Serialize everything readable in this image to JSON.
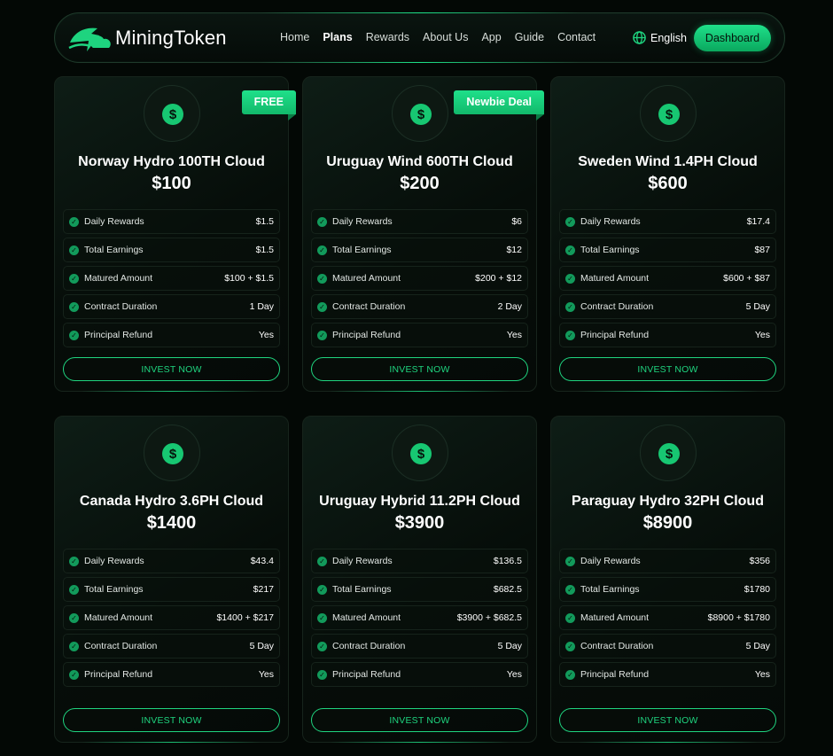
{
  "brand": {
    "name": "MiningToken",
    "accent": "#1de087"
  },
  "nav": {
    "links": [
      "Home",
      "Plans",
      "Rewards",
      "About Us",
      "App",
      "Guide",
      "Contact"
    ],
    "active": "Plans",
    "language": "English",
    "dashboard_label": "Dashboard"
  },
  "plans": [
    {
      "badge": "FREE",
      "name": "Norway Hydro 100TH Cloud",
      "price": "$100",
      "rows": [
        {
          "label": "Daily Rewards",
          "value": "$1.5"
        },
        {
          "label": "Total Earnings",
          "value": "$1.5"
        },
        {
          "label": "Matured Amount",
          "value": "$100 + $1.5"
        },
        {
          "label": "Contract Duration",
          "value": "1 Day"
        },
        {
          "label": "Principal Refund",
          "value": "Yes"
        }
      ],
      "cta": "INVEST NOW"
    },
    {
      "badge": "Newbie Deal",
      "name": "Uruguay Wind 600TH Cloud",
      "price": "$200",
      "rows": [
        {
          "label": "Daily Rewards",
          "value": "$6"
        },
        {
          "label": "Total Earnings",
          "value": "$12"
        },
        {
          "label": "Matured Amount",
          "value": "$200 + $12"
        },
        {
          "label": "Contract Duration",
          "value": "2 Day"
        },
        {
          "label": "Principal Refund",
          "value": "Yes"
        }
      ],
      "cta": "INVEST NOW"
    },
    {
      "badge": "",
      "name": "Sweden Wind 1.4PH Cloud",
      "price": "$600",
      "rows": [
        {
          "label": "Daily Rewards",
          "value": "$17.4"
        },
        {
          "label": "Total Earnings",
          "value": "$87"
        },
        {
          "label": "Matured Amount",
          "value": "$600 + $87"
        },
        {
          "label": "Contract Duration",
          "value": "5 Day"
        },
        {
          "label": "Principal Refund",
          "value": "Yes"
        }
      ],
      "cta": "INVEST NOW"
    },
    {
      "badge": "",
      "name": "Canada Hydro 3.6PH Cloud",
      "price": "$1400",
      "rows": [
        {
          "label": "Daily Rewards",
          "value": "$43.4"
        },
        {
          "label": "Total Earnings",
          "value": "$217"
        },
        {
          "label": "Matured Amount",
          "value": "$1400 + $217"
        },
        {
          "label": "Contract Duration",
          "value": "5 Day"
        },
        {
          "label": "Principal Refund",
          "value": "Yes"
        }
      ],
      "cta": "INVEST NOW"
    },
    {
      "badge": "",
      "name": "Uruguay Hybrid 11.2PH Cloud",
      "price": "$3900",
      "rows": [
        {
          "label": "Daily Rewards",
          "value": "$136.5"
        },
        {
          "label": "Total Earnings",
          "value": "$682.5"
        },
        {
          "label": "Matured Amount",
          "value": "$3900 + $682.5"
        },
        {
          "label": "Contract Duration",
          "value": "5 Day"
        },
        {
          "label": "Principal Refund",
          "value": "Yes"
        }
      ],
      "cta": "INVEST NOW"
    },
    {
      "badge": "",
      "name": "Paraguay Hydro 32PH Cloud",
      "price": "$8900",
      "rows": [
        {
          "label": "Daily Rewards",
          "value": "$356"
        },
        {
          "label": "Total Earnings",
          "value": "$1780"
        },
        {
          "label": "Matured Amount",
          "value": "$8900 + $1780"
        },
        {
          "label": "Contract Duration",
          "value": "5 Day"
        },
        {
          "label": "Principal Refund",
          "value": "Yes"
        }
      ],
      "cta": "INVEST NOW"
    }
  ]
}
